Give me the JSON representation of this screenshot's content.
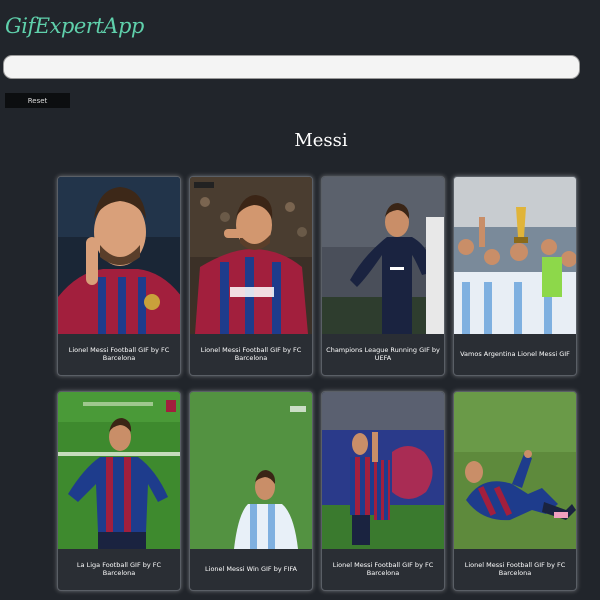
{
  "app": {
    "title": "GifExpertApp"
  },
  "search": {
    "value": "",
    "placeholder": ""
  },
  "reset": {
    "label": "Reset"
  },
  "category": {
    "title": "Messi"
  },
  "gifs": [
    {
      "caption": "Lionel Messi Football GIF by FC Barcelona"
    },
    {
      "caption": "Lionel Messi Football GIF by FC Barcelona"
    },
    {
      "caption": "Champions League Running GIF by UEFA"
    },
    {
      "caption": "Vamos Argentina Lionel Messi GIF"
    },
    {
      "caption": "La Liga Football GIF by FC Barcelona"
    },
    {
      "caption": "Lionel Messi Win GIF by FIFA"
    },
    {
      "caption": "Lionel Messi Football GIF by FC Barcelona"
    },
    {
      "caption": "Lionel Messi Football GIF by FC Barcelona"
    }
  ]
}
